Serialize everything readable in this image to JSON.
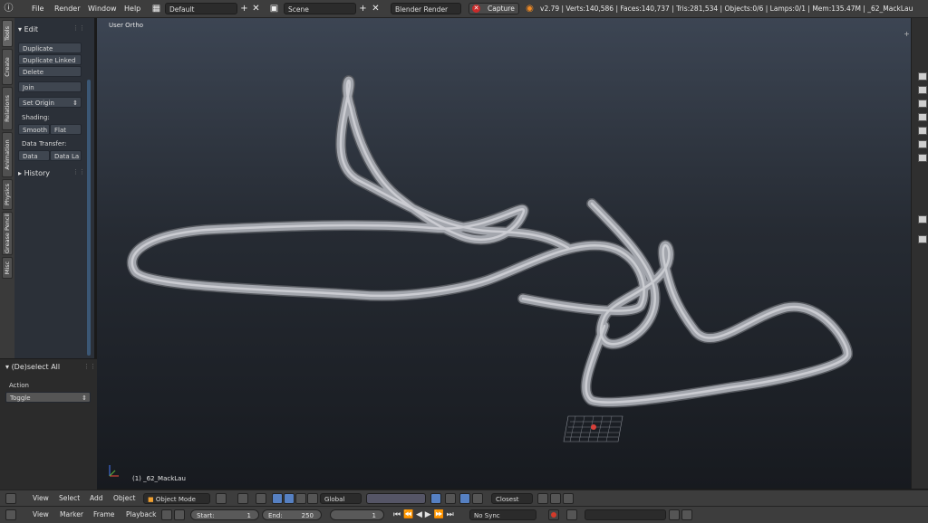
{
  "menu": {
    "file": "File",
    "render": "Render",
    "window": "Window",
    "help": "Help"
  },
  "layout_name": "Default",
  "scene_name": "Scene",
  "engine": "Blender Render",
  "capture": "Capture",
  "stats": "v2.79 | Verts:140,586 | Faces:140,737 | Tris:281,534 | Objects:0/6 | Lamps:0/1 | Mem:135.47M | _62_MackLau",
  "tabs": [
    "Tools",
    "Create",
    "Relations",
    "Animation",
    "Physics",
    "Grease Pencil",
    "Misc"
  ],
  "tools": {
    "edit_title": "Edit",
    "duplicate": "Duplicate",
    "duplicate_linked": "Duplicate Linked",
    "delete": "Delete",
    "join": "Join",
    "set_origin": "Set Origin",
    "shading_label": "Shading:",
    "smooth": "Smooth",
    "flat": "Flat",
    "data_transfer_label": "Data Transfer:",
    "data": "Data",
    "data_layout": "Data La",
    "history": "History"
  },
  "operator": {
    "title": "(De)select All",
    "action_label": "Action",
    "action_value": "Toggle"
  },
  "viewport": {
    "view_name": "User Ortho",
    "object_label": "(1) _62_MackLau"
  },
  "header3d": {
    "view": "View",
    "select": "Select",
    "add": "Add",
    "object": "Object",
    "mode": "Object Mode",
    "orientation": "Global",
    "snap": "Closest"
  },
  "timeline": {
    "view": "View",
    "marker": "Marker",
    "frame": "Frame",
    "playback": "Playback",
    "start_label": "Start:",
    "start_value": "1",
    "end_label": "End:",
    "end_value": "250",
    "current_frame": "1",
    "sync": "No Sync"
  }
}
